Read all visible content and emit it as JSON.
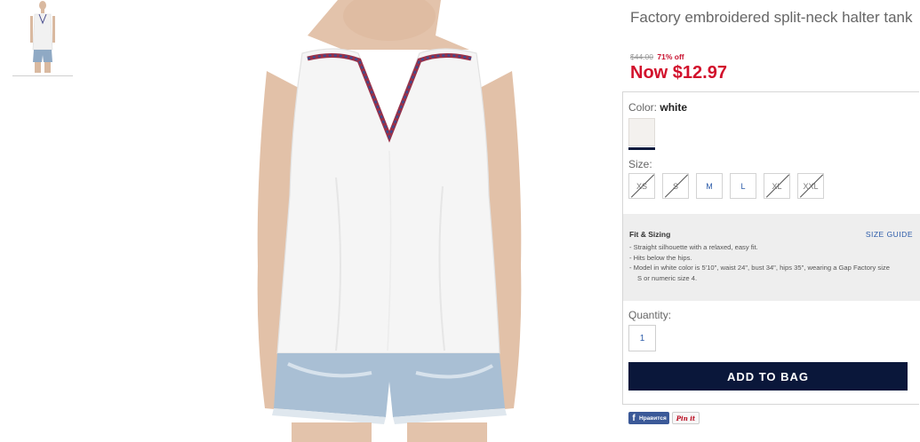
{
  "product": {
    "title": "Factory embroidered split-neck halter tank",
    "old_price": "$44.00",
    "discount": "71% off",
    "now_price": "Now $12.97"
  },
  "color": {
    "label": "Color:",
    "value": "white",
    "swatch_hex": "#f3f1ee"
  },
  "size": {
    "label": "Size:",
    "options": [
      {
        "label": "XS",
        "available": false
      },
      {
        "label": "S",
        "available": false
      },
      {
        "label": "M",
        "available": true
      },
      {
        "label": "L",
        "available": true
      },
      {
        "label": "XL",
        "available": false
      },
      {
        "label": "XXL",
        "available": false
      }
    ]
  },
  "fit": {
    "title": "Fit & Sizing",
    "size_guide": "SIZE GUIDE",
    "items": [
      "Straight silhouette with a relaxed, easy fit.",
      "Hits below the hips.",
      "Model in white color is 5'10\", waist 24\", bust 34\", hips 35\", wearing a Gap Factory size S or numeric size 4."
    ]
  },
  "quantity": {
    "label": "Quantity:",
    "value": "1"
  },
  "add_to_bag": "ADD TO BAG",
  "social": {
    "facebook": "Нравится",
    "pinterest": "Pin it"
  },
  "colors": {
    "sale_red": "#d2112c",
    "navy": "#0a173a",
    "link_blue": "#2a5aa8"
  }
}
